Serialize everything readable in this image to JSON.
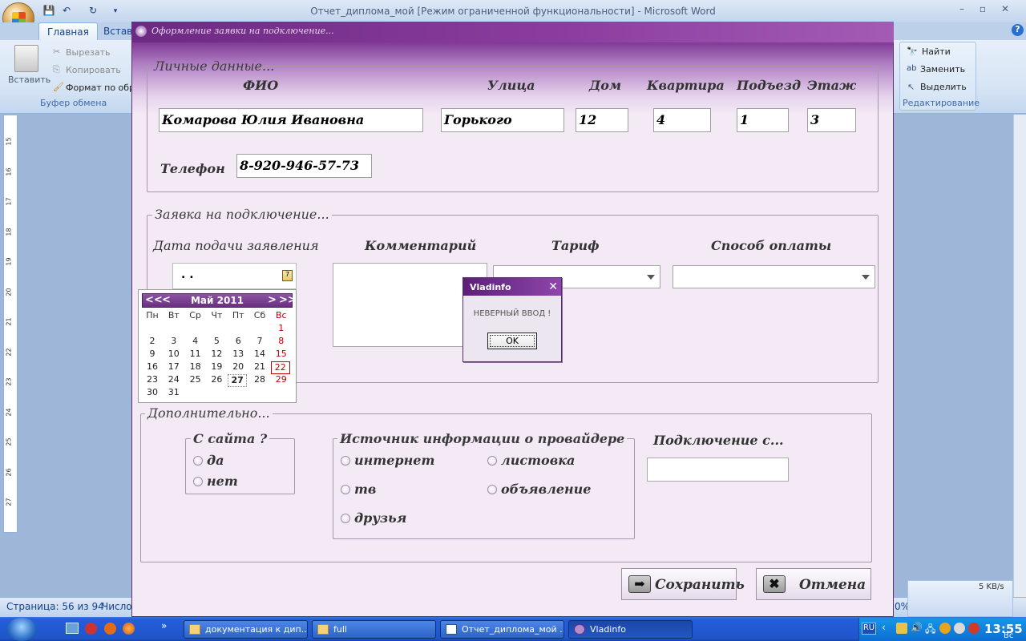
{
  "word": {
    "title": "Отчет_диплома_мой [Режим ограниченной функциональности] - Microsoft Word",
    "tabs": [
      "Главная",
      "Вставка"
    ],
    "clipboard": {
      "paste": "Вставить",
      "cut": "Вырезать",
      "copy": "Копировать",
      "format_painter": "Формат по обр",
      "group": "Буфер обмена"
    },
    "editing": {
      "find": "Найти",
      "replace": "Заменить",
      "select": "Выделить",
      "group": "Редактирование"
    },
    "ruler_numbers": [
      "15",
      "16",
      "17",
      "18",
      "19",
      "20",
      "21",
      "22",
      "23",
      "24",
      "25",
      "26",
      "27"
    ],
    "status": {
      "page": "Страница: 56 из 94",
      "words": "Число",
      "zoom": "0%",
      "speed": "5 KB/s"
    }
  },
  "dialog": {
    "title": "Оформление заявки на подключение...",
    "personal": {
      "legend": "Личные данные...",
      "headers": {
        "fio": "ФИО",
        "street": "Улица",
        "house": "Дом",
        "apartment": "Квартира",
        "entrance": "Подъезд",
        "floor": "Этаж"
      },
      "values": {
        "fio": "Комарова Юлия Ивановна",
        "street": "Горького",
        "house": "12",
        "apartment": "4",
        "entrance": "1",
        "floor": "3"
      },
      "phone_label": "Телефон",
      "phone_value": "8-920-946-57-73"
    },
    "request": {
      "legend": "Заявка на подключение...",
      "date_label": "Дата подачи заявления",
      "date_value": ". .",
      "comment_label": "Комментарий",
      "tariff_label": "Тариф",
      "payment_label": "Способ оплаты"
    },
    "calendar": {
      "month": "Май 2011",
      "nav": {
        "prev_year": "<<",
        "prev": "<",
        "next": ">",
        "next_year": ">>"
      },
      "weekdays": [
        "Пн",
        "Вт",
        "Ср",
        "Чт",
        "Пт",
        "Сб",
        "Вс"
      ],
      "weeks": [
        [
          "",
          "",
          "",
          "",
          "",
          "",
          "1"
        ],
        [
          "2",
          "3",
          "4",
          "5",
          "6",
          "7",
          "8"
        ],
        [
          "9",
          "10",
          "11",
          "12",
          "13",
          "14",
          "15"
        ],
        [
          "16",
          "17",
          "18",
          "19",
          "20",
          "21",
          "22"
        ],
        [
          "23",
          "24",
          "25",
          "26",
          "27",
          "28",
          "29"
        ],
        [
          "30",
          "31",
          "",
          "",
          "",
          "",
          ""
        ]
      ],
      "selected": "22",
      "today": "27"
    },
    "extra": {
      "legend": "Дополнительно...",
      "site_legend": "С сайта ?",
      "site_options": [
        "да",
        "нет"
      ],
      "source_legend": "Источник информации о провайдере",
      "source_options": [
        "интернет",
        "листовка",
        "тв",
        "объявление",
        "друзья"
      ],
      "connect_label": "Подключение с..."
    },
    "buttons": {
      "save": "Сохранить",
      "cancel": "Отмена"
    }
  },
  "message_box": {
    "title": "Vladinfo",
    "text": "НЕВЕРНЫЙ ВВОД !",
    "ok": "OK"
  },
  "taskbar": {
    "items": [
      "документация к дип...",
      "full",
      "Отчет_диплома_мой ...",
      "Vladinfo"
    ],
    "language": "RU",
    "time": "13:55",
    "day": "Вс"
  }
}
